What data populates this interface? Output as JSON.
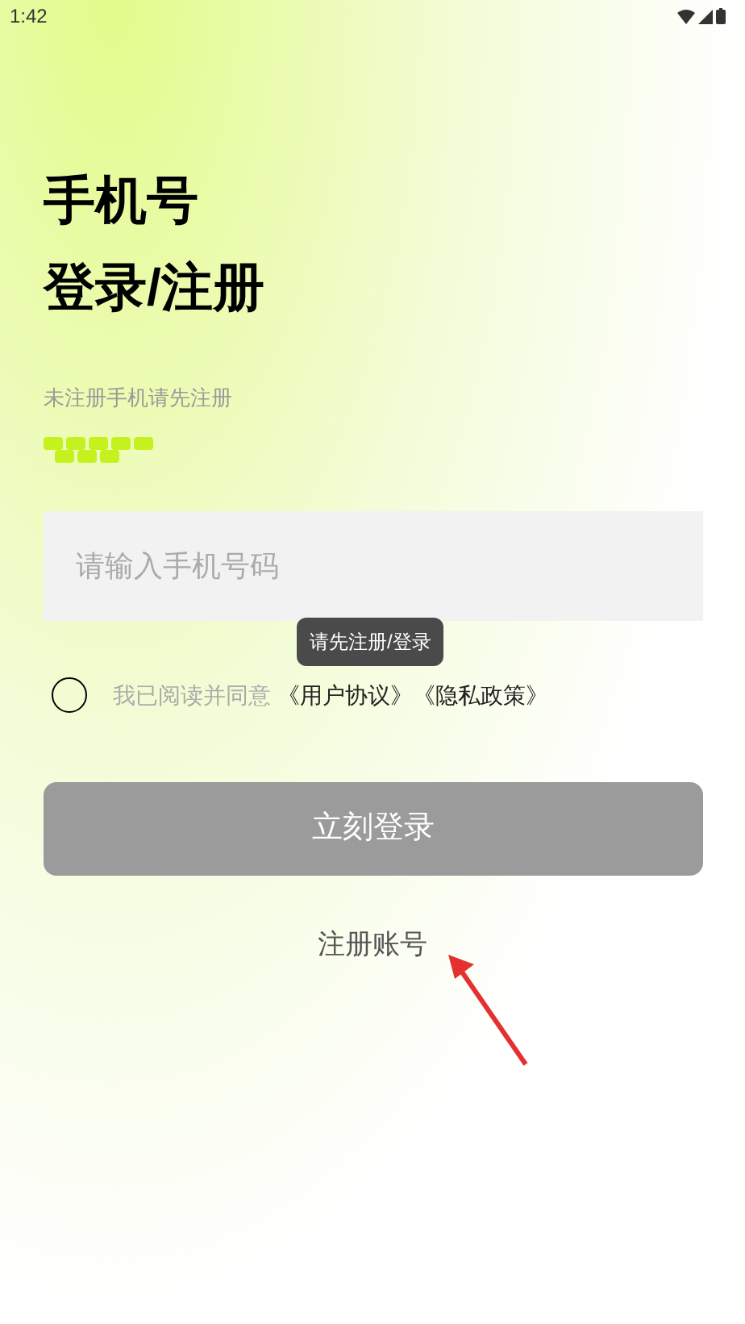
{
  "status_bar": {
    "time": "1:42"
  },
  "heading": [
    "手机号",
    "登录/注册"
  ],
  "subtitle": "未注册手机请先注册",
  "phone_field": {
    "placeholder": "请输入手机号码"
  },
  "agreement": {
    "checked": false,
    "text": "我已阅读并同意",
    "links": [
      "《用户协议》",
      "《隐私政策》"
    ]
  },
  "tooltip": "请先注册/登录",
  "login_button": {
    "label": "立刻登录",
    "disabled": true
  },
  "register_link": "注册账号"
}
